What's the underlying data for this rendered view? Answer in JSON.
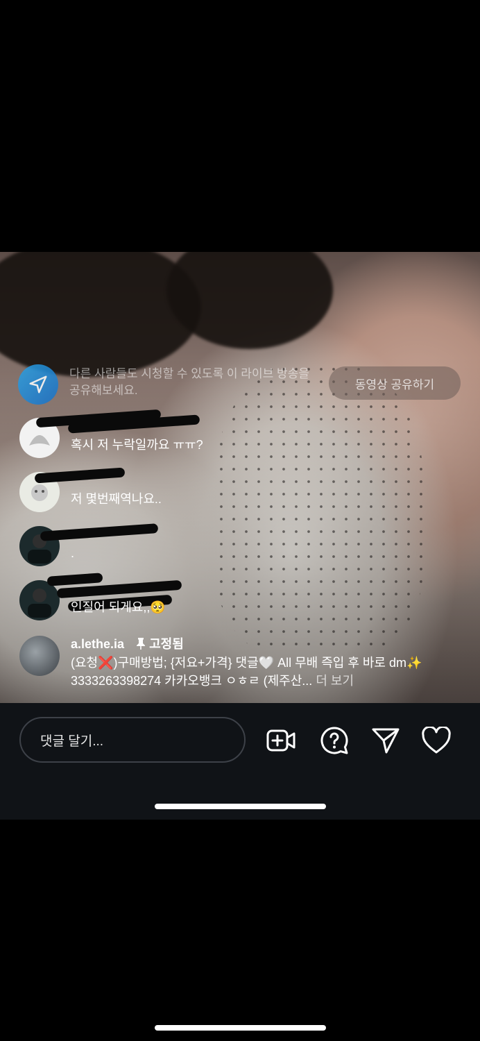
{
  "share_banner": {
    "text": "다른 사람들도 시청할 수 있도록 이 라이브 방송을 공유해보세요.",
    "button_label": "동영상 공유하기"
  },
  "comments": [
    {
      "username": "",
      "text": "혹시 저 누락일까요 ㅠㅠ?"
    },
    {
      "username": "",
      "text": "저 몇번째역나요.."
    },
    {
      "username": "",
      "text": "."
    },
    {
      "username": "",
      "text": "인질어 되게요,,🥺"
    }
  ],
  "pinned": {
    "username": "a.lethe.ia",
    "pin_label": "고정됨",
    "text": "(요청❌)구매방법; {저요+가격} 댓글🤍 All 무배 즉입 후 바로 dm✨ 3333263398274 카카오뱅크 ㅇㅎㄹ (제주산...",
    "more_label": "더 보기"
  },
  "bottom_bar": {
    "comment_placeholder": "댓글 달기..."
  },
  "icons": {
    "share_avatar": "paper-plane-icon",
    "add_video": "add-video-icon",
    "question": "question-bubble-icon",
    "send": "send-icon",
    "like": "heart-icon",
    "pin": "pin-icon"
  }
}
